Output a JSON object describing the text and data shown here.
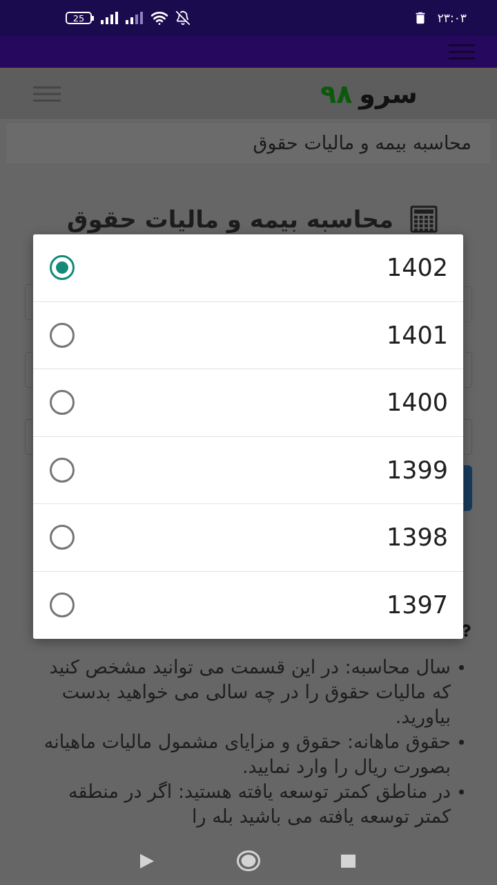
{
  "status_bar": {
    "battery": "25",
    "time": "۲۳:۰۳"
  },
  "header": {
    "logo": {
      "word": "سرو",
      "number": "۹۸"
    }
  },
  "breadcrumb": {
    "text": "محاسبه بیمه و مالیات حقوق"
  },
  "page_title": {
    "text": "محاسبه بیمه و مالیات حقوق"
  },
  "help_list": {
    "items": [
      "سال محاسبه: در این قسمت می توانید مشخص کنید که مالیات حقوق را در چه سالی می خواهید بدست بیاورید.",
      "حقوق ماهانه: حقوق و مزایای مشمول مالیات ماهیانه بصورت ریال را وارد نمایید.",
      "در مناطق کمتر توسعه یافته هستید: اگر در منطقه کمتر توسعه یافته می باشید بله را"
    ]
  },
  "year_dialog": {
    "options": [
      {
        "label": "1402",
        "selected": true
      },
      {
        "label": "1401",
        "selected": false
      },
      {
        "label": "1400",
        "selected": false
      },
      {
        "label": "1399",
        "selected": false
      },
      {
        "label": "1398",
        "selected": false
      },
      {
        "label": "1397",
        "selected": false
      }
    ]
  }
}
